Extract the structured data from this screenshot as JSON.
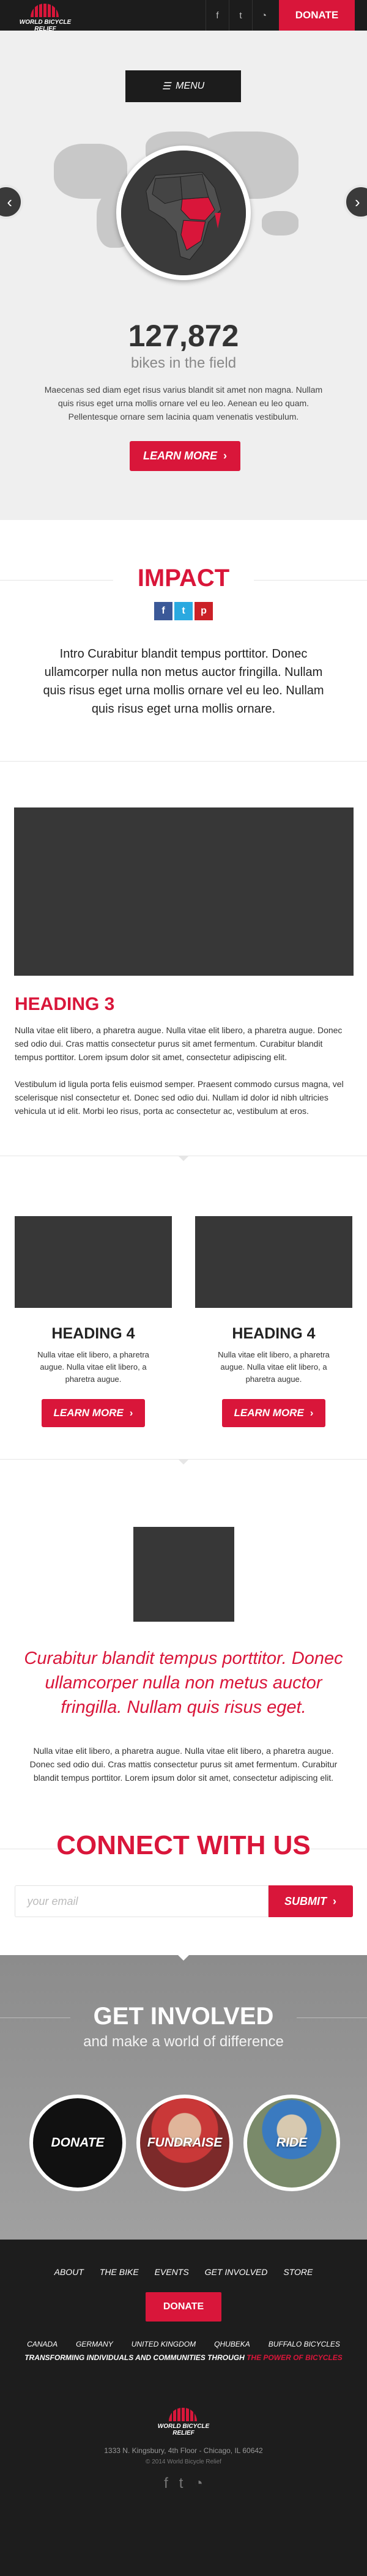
{
  "header": {
    "logo_text": "WORLD BICYCLE RELIEF",
    "social_icons": [
      "facebook-icon",
      "twitter-icon",
      "rss-icon"
    ],
    "donate_label": "Donate"
  },
  "hero": {
    "menu_label": "MENU",
    "stat_number": "127,872",
    "stat_label": "bikes in the field",
    "text": "Maecenas sed diam eget risus varius blandit sit amet non magna. Nullam quis risus eget urna mollis ornare vel eu leo. Aenean eu leo quam. Pellentesque ornare sem lacinia quam venenatis vestibulum.",
    "button_label": "Learn More",
    "prev_arrow": "‹",
    "next_arrow": "›"
  },
  "impact": {
    "title": "Impact",
    "intro": "Intro Curabitur blandit tempus porttitor. Donec ullamcorper nulla non metus auctor fringilla. Nullam quis risus eget urna mollis ornare vel eu leo. Nullam quis risus eget urna mollis ornare.",
    "heading3": "Heading 3",
    "para1": "Nulla vitae elit libero, a pharetra augue. Nulla vitae elit libero, a pharetra augue. Donec sed odio dui. Cras mattis consectetur purus sit amet fermentum. Curabitur blandit tempus porttitor. Lorem ipsum dolor sit amet, consectetur adipiscing elit.",
    "para2": "Vestibulum id ligula porta felis euismod semper. Praesent commodo cursus magna, vel scelerisque nisl consectetur et. Donec sed odio dui. Nullam id dolor id nibh ultricies vehicula ut id elit. Morbi leo risus, porta ac consectetur ac, vestibulum at eros."
  },
  "columns": [
    {
      "heading": "Heading 4",
      "text": "Nulla vitae elit libero, a pharetra augue. Nulla vitae elit libero, a pharetra augue.",
      "button": "Learn More"
    },
    {
      "heading": "Heading 4",
      "text": "Nulla vitae elit libero, a pharetra augue. Nulla vitae elit libero, a pharetra augue.",
      "button": "Learn More"
    }
  ],
  "quote": {
    "text": "Curabitur blandit tempus porttitor. Donec ullamcorper nulla non metus auctor fringilla. Nullam quis risus eget.",
    "para": "Nulla vitae elit libero, a pharetra augue. Nulla vitae elit libero, a pharetra augue. Donec sed odio dui. Cras mattis consectetur purus sit amet fermentum. Curabitur blandit tempus porttitor. Lorem ipsum dolor sit amet, consectetur adipiscing elit."
  },
  "connect": {
    "title": "Connect with us",
    "email_placeholder": "your email",
    "submit_label": "Submit"
  },
  "involved": {
    "title": "Get Involved",
    "subtitle": "and make a world of difference",
    "items": [
      "Donate",
      "Fundraise",
      "Ride"
    ]
  },
  "footer": {
    "nav": [
      "About",
      "The Bike",
      "Events",
      "Get Involved",
      "Store"
    ],
    "donate_label": "Donate",
    "countries": [
      "Canada",
      "Germany",
      "United Kingdom",
      "Qhubeka",
      "Buffalo Bicycles"
    ],
    "tagline_start": "Transforming individuals and communities through",
    "tagline_end": "the power of bicycles",
    "address": "1333 N. Kingsbury, 4th Floor - Chicago, IL 60642",
    "copyright": "© 2014 World Bicycle Relief",
    "icons": [
      "facebook-icon",
      "twitter-icon",
      "rss-icon"
    ]
  },
  "colors": {
    "accent": "#d9163a",
    "dark": "#1c1c1c",
    "placeholder_block": "#373737"
  }
}
